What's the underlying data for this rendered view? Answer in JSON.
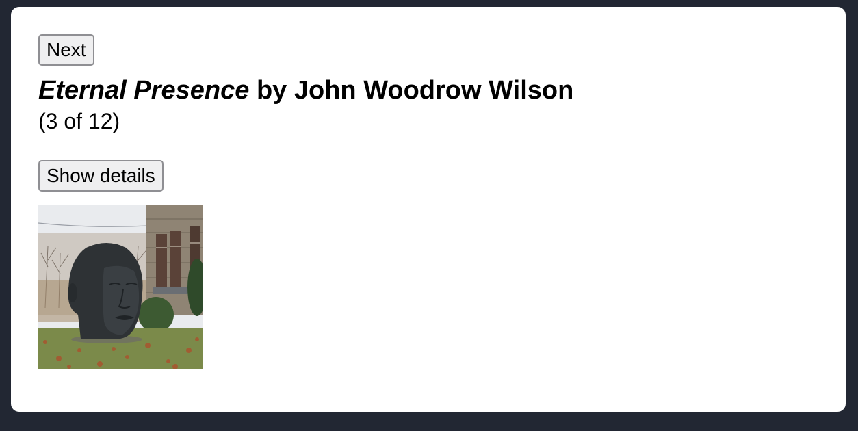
{
  "nav": {
    "next_label": "Next"
  },
  "artwork": {
    "title": "Eternal Presence",
    "by_text": " by John Woodrow Wilson",
    "counter": "(3 of 12)"
  },
  "details": {
    "toggle_label": "Show details"
  }
}
